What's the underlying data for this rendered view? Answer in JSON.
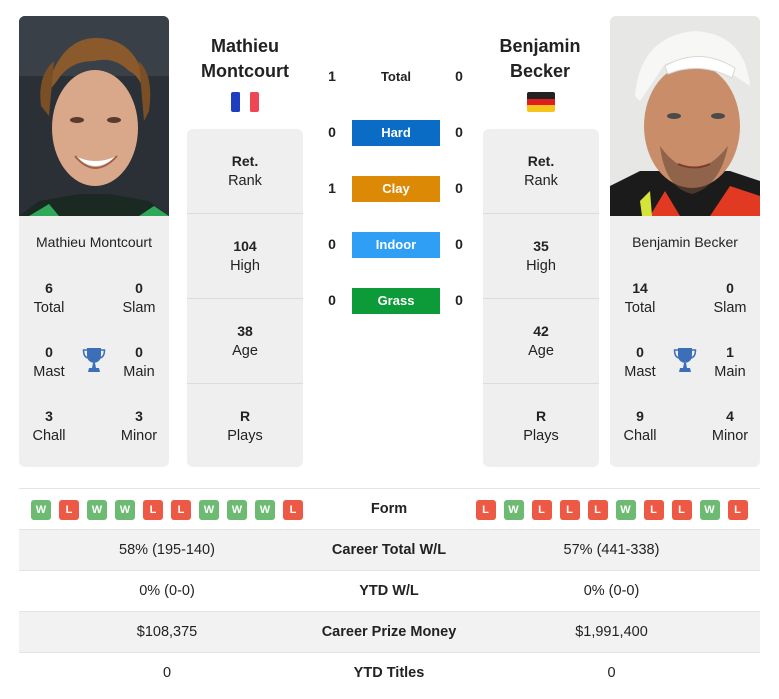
{
  "players": {
    "left": {
      "name_line1": "Mathieu",
      "name_line2": "Montcourt",
      "full_name": "Mathieu Montcourt",
      "flag": "france-flag",
      "titles": {
        "total": {
          "value": "6",
          "label": "Total"
        },
        "slam": {
          "value": "0",
          "label": "Slam"
        },
        "mast": {
          "value": "0",
          "label": "Mast"
        },
        "main": {
          "value": "0",
          "label": "Main"
        },
        "chall": {
          "value": "3",
          "label": "Chall"
        },
        "minor": {
          "value": "3",
          "label": "Minor"
        }
      },
      "info": {
        "rank": {
          "value": "Ret.",
          "label": "Rank"
        },
        "high": {
          "value": "104",
          "label": "High"
        },
        "age": {
          "value": "38",
          "label": "Age"
        },
        "plays": {
          "value": "R",
          "label": "Plays"
        }
      }
    },
    "right": {
      "name_line1": "Benjamin",
      "name_line2": "Becker",
      "full_name": "Benjamin Becker",
      "flag": "germany-flag",
      "titles": {
        "total": {
          "value": "14",
          "label": "Total"
        },
        "slam": {
          "value": "0",
          "label": "Slam"
        },
        "mast": {
          "value": "0",
          "label": "Mast"
        },
        "main": {
          "value": "1",
          "label": "Main"
        },
        "chall": {
          "value": "9",
          "label": "Chall"
        },
        "minor": {
          "value": "4",
          "label": "Minor"
        }
      },
      "info": {
        "rank": {
          "value": "Ret.",
          "label": "Rank"
        },
        "high": {
          "value": "35",
          "label": "High"
        },
        "age": {
          "value": "42",
          "label": "Age"
        },
        "plays": {
          "value": "R",
          "label": "Plays"
        }
      }
    }
  },
  "h2h": {
    "total": {
      "label": "Total",
      "left": "1",
      "right": "0"
    },
    "surfaces": [
      {
        "label": "Hard",
        "left": "0",
        "right": "0",
        "color": "#0a6cc4"
      },
      {
        "label": "Clay",
        "left": "1",
        "right": "0",
        "color": "#dc8a06"
      },
      {
        "label": "Indoor",
        "left": "0",
        "right": "0",
        "color": "#2f9ff5"
      },
      {
        "label": "Grass",
        "left": "0",
        "right": "0",
        "color": "#0d9a38"
      }
    ]
  },
  "comparison": {
    "form_label": "Form",
    "form_left": [
      "W",
      "L",
      "W",
      "W",
      "L",
      "L",
      "W",
      "W",
      "W",
      "L"
    ],
    "form_right": [
      "L",
      "W",
      "L",
      "L",
      "L",
      "W",
      "L",
      "L",
      "W",
      "L"
    ],
    "rows": [
      {
        "label": "Career Total W/L",
        "left": "58% (195-140)",
        "right": "57% (441-338)"
      },
      {
        "label": "YTD W/L",
        "left": "0% (0-0)",
        "right": "0% (0-0)"
      },
      {
        "label": "Career Prize Money",
        "left": "$108,375",
        "right": "$1,991,400"
      },
      {
        "label": "YTD Titles",
        "left": "0",
        "right": "0"
      }
    ]
  },
  "colors": {
    "win": "#6dbb72",
    "loss": "#ec5a45",
    "trophy": "#3d6fb8",
    "card_bg": "#efefef"
  }
}
